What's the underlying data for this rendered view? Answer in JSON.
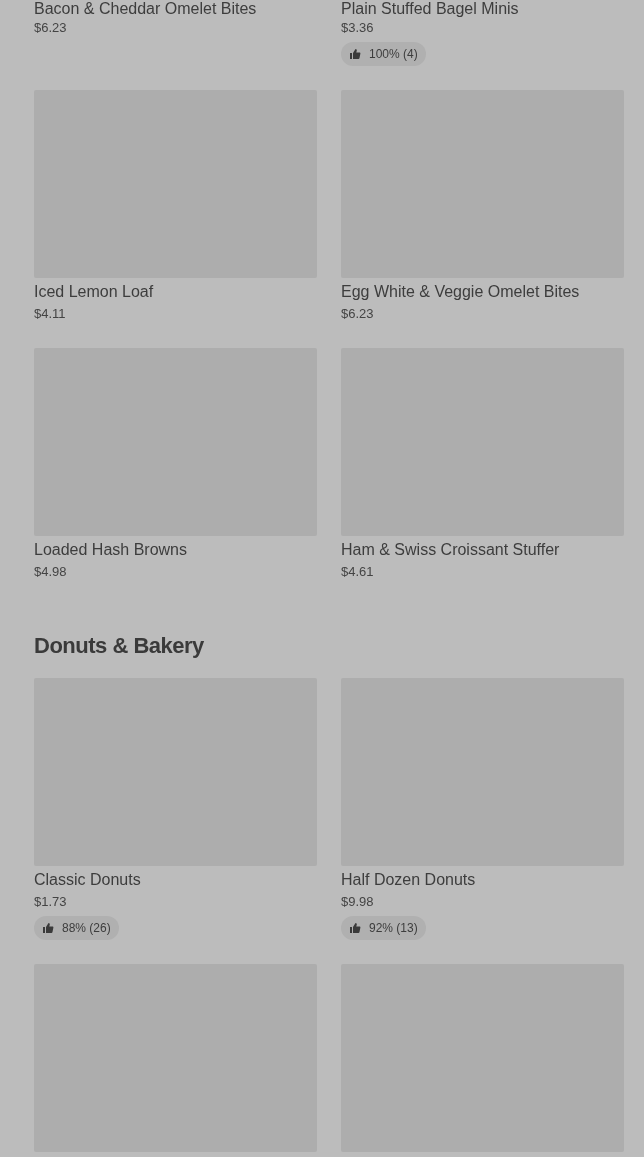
{
  "sections": [
    {
      "items": [
        {
          "kind": "text_only",
          "name": "Bacon & Cheddar Omelet Bites",
          "price": "$6.23"
        },
        {
          "kind": "text_only",
          "name": "Plain Stuffed Bagel Minis",
          "price": "$3.36",
          "rating": "100% (4)"
        },
        {
          "kind": "card",
          "name": "Iced Lemon Loaf",
          "price": "$4.11"
        },
        {
          "kind": "card",
          "name": "Egg White & Veggie Omelet Bites",
          "price": "$6.23"
        },
        {
          "kind": "card",
          "name": "Loaded Hash Browns",
          "price": "$4.98"
        },
        {
          "kind": "card",
          "name": "Ham & Swiss Croissant Stuffer",
          "price": "$4.61"
        }
      ]
    },
    {
      "title": "Donuts & Bakery",
      "items": [
        {
          "kind": "card",
          "name": "Classic Donuts",
          "price": "$1.73",
          "rating": "88% (26)"
        },
        {
          "kind": "card",
          "name": "Half Dozen Donuts",
          "price": "$9.98",
          "rating": "92% (13)"
        },
        {
          "kind": "card"
        },
        {
          "kind": "card"
        }
      ]
    }
  ]
}
